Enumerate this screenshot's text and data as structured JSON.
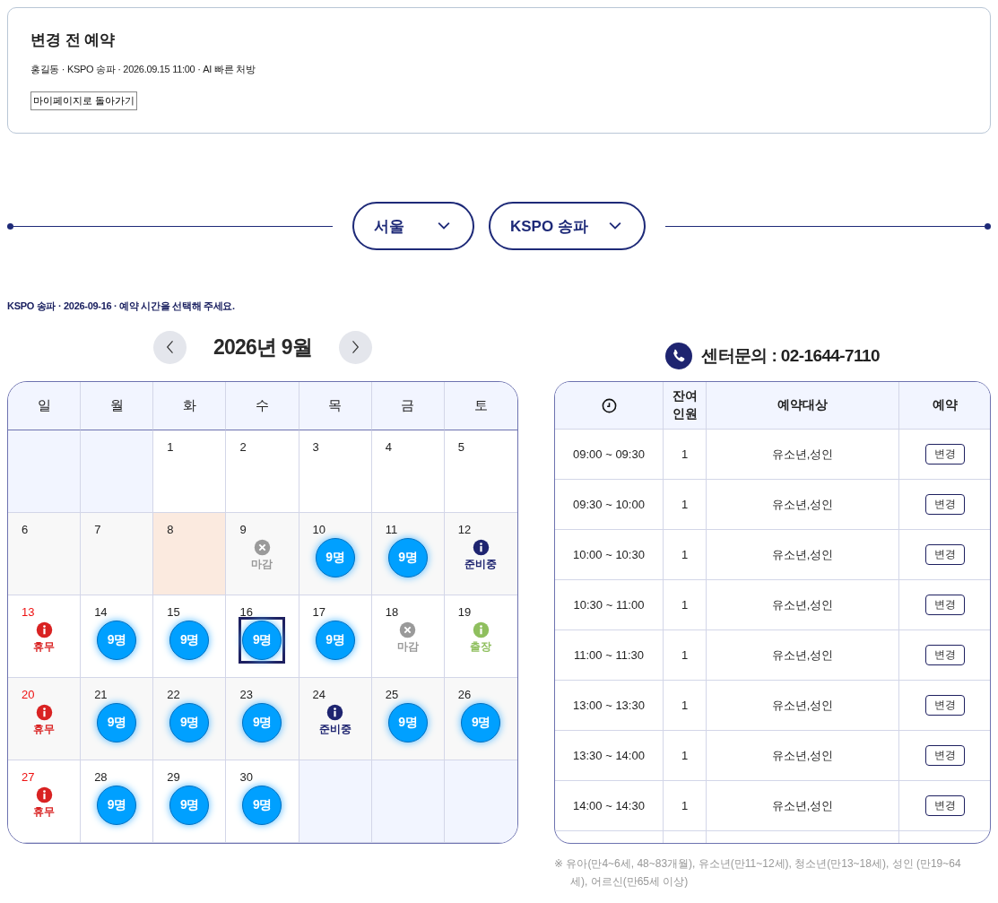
{
  "booking_card": {
    "title": "변경 전 예약",
    "details": "홍길동 · KSPO 송파 · 2026.09.15 11:00 · AI 빠른 처방",
    "back_button": "마이페이지로 돌아가기"
  },
  "filters": [
    {
      "label": "서울"
    },
    {
      "label": "KSPO 송파"
    }
  ],
  "instruction": "KSPO 송파 · 2026-09-16 · 예약 시간을 선택해 주세요.",
  "calendar": {
    "title": "2026년 9월",
    "weekdays": [
      "일",
      "월",
      "화",
      "수",
      "목",
      "금",
      "토"
    ],
    "weeks": [
      [
        {
          "kind": "empty"
        },
        {
          "kind": "empty"
        },
        {
          "day": "1",
          "kind": "plain"
        },
        {
          "day": "2",
          "kind": "plain"
        },
        {
          "day": "3",
          "kind": "plain"
        },
        {
          "day": "4",
          "kind": "plain"
        },
        {
          "day": "5",
          "kind": "plain"
        }
      ],
      [
        {
          "day": "6",
          "kind": "plain"
        },
        {
          "day": "7",
          "kind": "plain"
        },
        {
          "day": "8",
          "kind": "today"
        },
        {
          "day": "9",
          "kind": "closed",
          "label": "마감"
        },
        {
          "day": "10",
          "kind": "available",
          "label": "9명",
          "selected": false
        },
        {
          "day": "11",
          "kind": "available",
          "label": "9명",
          "selected": false
        },
        {
          "day": "12",
          "kind": "preparing",
          "label": "준비중"
        }
      ],
      [
        {
          "day": "13",
          "kind": "rest",
          "label": "휴무"
        },
        {
          "day": "14",
          "kind": "available",
          "label": "9명",
          "selected": false
        },
        {
          "day": "15",
          "kind": "available",
          "label": "9명",
          "selected": false
        },
        {
          "day": "16",
          "kind": "available",
          "label": "9명",
          "selected": true
        },
        {
          "day": "17",
          "kind": "available",
          "label": "9명",
          "selected": false
        },
        {
          "day": "18",
          "kind": "closed",
          "label": "마감"
        },
        {
          "day": "19",
          "kind": "trip",
          "label": "출장"
        }
      ],
      [
        {
          "day": "20",
          "kind": "rest",
          "label": "휴무"
        },
        {
          "day": "21",
          "kind": "available",
          "label": "9명",
          "selected": false
        },
        {
          "day": "22",
          "kind": "available",
          "label": "9명",
          "selected": false
        },
        {
          "day": "23",
          "kind": "available",
          "label": "9명",
          "selected": false
        },
        {
          "day": "24",
          "kind": "preparing",
          "label": "준비중"
        },
        {
          "day": "25",
          "kind": "available",
          "label": "9명",
          "selected": false
        },
        {
          "day": "26",
          "kind": "available",
          "label": "9명",
          "selected": false
        }
      ],
      [
        {
          "day": "27",
          "kind": "rest",
          "label": "휴무"
        },
        {
          "day": "28",
          "kind": "available",
          "label": "9명",
          "selected": false
        },
        {
          "day": "29",
          "kind": "available",
          "label": "9명",
          "selected": false
        },
        {
          "day": "30",
          "kind": "available",
          "label": "9명",
          "selected": false
        },
        {
          "kind": "empty"
        },
        {
          "kind": "empty"
        },
        {
          "kind": "empty"
        }
      ]
    ]
  },
  "contact": "센터문의 : 02-1644-7110",
  "slots_table": {
    "columns": [
      "잔여 인원",
      "예약대상",
      "예약"
    ],
    "rows": [
      {
        "time": "09:00 ~ 09:30",
        "remaining": "1",
        "target": "유소년,성인",
        "action": "변경"
      },
      {
        "time": "09:30 ~ 10:00",
        "remaining": "1",
        "target": "유소년,성인",
        "action": "변경"
      },
      {
        "time": "10:00 ~ 10:30",
        "remaining": "1",
        "target": "유소년,성인",
        "action": "변경"
      },
      {
        "time": "10:30 ~ 11:00",
        "remaining": "1",
        "target": "유소년,성인",
        "action": "변경"
      },
      {
        "time": "11:00 ~ 11:30",
        "remaining": "1",
        "target": "유소년,성인",
        "action": "변경"
      },
      {
        "time": "13:00 ~ 13:30",
        "remaining": "1",
        "target": "유소년,성인",
        "action": "변경"
      },
      {
        "time": "13:30 ~ 14:00",
        "remaining": "1",
        "target": "유소년,성인",
        "action": "변경"
      },
      {
        "time": "14:00 ~ 14:30",
        "remaining": "1",
        "target": "유소년,성인",
        "action": "변경"
      }
    ]
  },
  "note": "※ 유아(만4~6세, 48~83개월), 유소년(만11~12세), 청소년(만13~18세), 성인 (만19~64세), 어르신(만65세 이상)"
}
